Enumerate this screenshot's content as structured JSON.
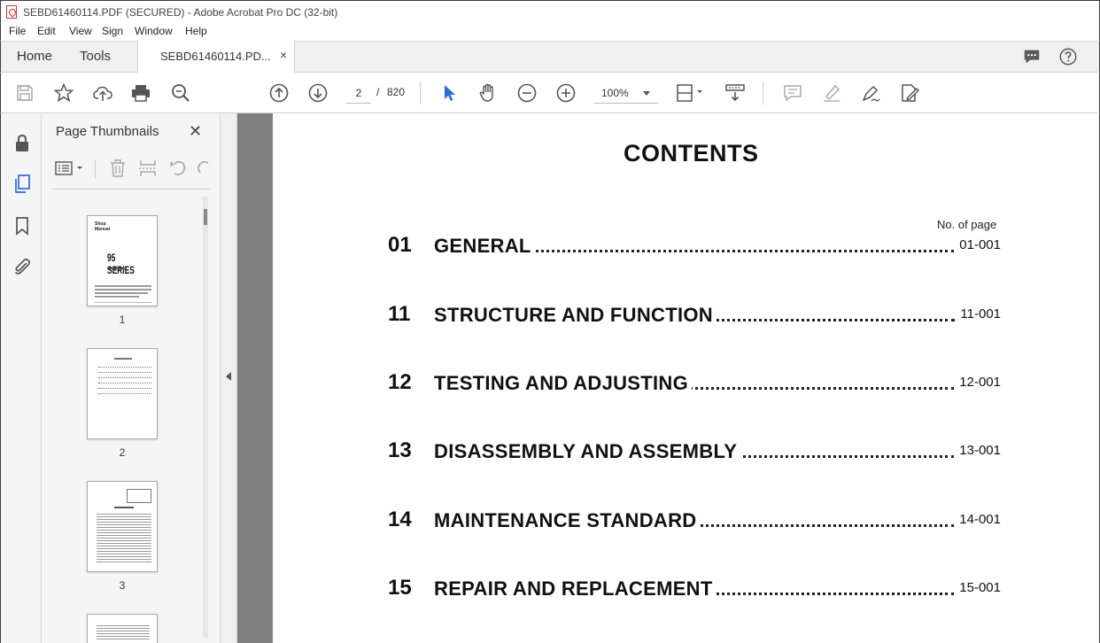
{
  "window": {
    "title": "SEBD61460114.PDF (SECURED) - Adobe Acrobat Pro DC (32-bit)"
  },
  "menu": [
    "File",
    "Edit",
    "View",
    "Sign",
    "Window",
    "Help"
  ],
  "tabs": {
    "home": "Home",
    "tools": "Tools",
    "document": "SEBD61460114.PD...",
    "close": "×"
  },
  "toolbar": {
    "current_page": "2",
    "separator": "/",
    "total_pages": "820",
    "zoom": "100%"
  },
  "panel": {
    "title": "Page Thumbnails",
    "close": "✕",
    "thumbnails": [
      {
        "number": "1"
      },
      {
        "number": "2"
      },
      {
        "number": "3"
      }
    ]
  },
  "document": {
    "heading": "CONTENTS",
    "page_col_header": "No. of page",
    "entries": [
      {
        "num": "01",
        "label": "GENERAL",
        "page": "01-001"
      },
      {
        "num": "11",
        "label": "STRUCTURE AND FUNCTION",
        "page": "11-001"
      },
      {
        "num": "12",
        "label": "TESTING AND ADJUSTING",
        "page": "12-001"
      },
      {
        "num": "13",
        "label": "DISASSEMBLY AND ASSEMBLY",
        "page": "13-001"
      },
      {
        "num": "14",
        "label": "MAINTENANCE STANDARD",
        "page": "14-001"
      },
      {
        "num": "15",
        "label": "REPAIR AND REPLACEMENT",
        "page": "15-001"
      }
    ]
  },
  "thumb1": {
    "line1": "Shop",
    "line2": "Manual",
    "series": "95 SERIES"
  },
  "icons": {
    "titlebar": "pdf-app-icon",
    "comment": "comment-icon",
    "help": "help-icon"
  },
  "colors": {
    "accent_blue": "#2a6dd6",
    "gray_bg": "#808080"
  }
}
